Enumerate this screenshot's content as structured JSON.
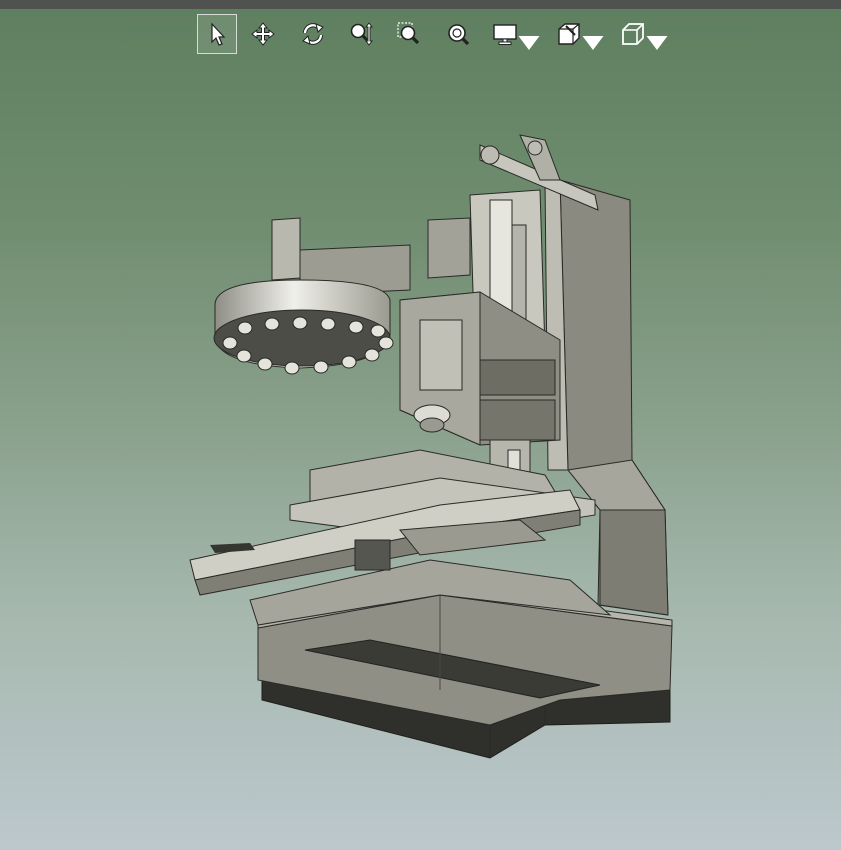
{
  "toolbar": {
    "tools": [
      {
        "id": "select",
        "icon": "select-arrow-icon",
        "active": true,
        "dropdown": false
      },
      {
        "id": "pan",
        "icon": "pan-move-icon",
        "active": false,
        "dropdown": false
      },
      {
        "id": "rotate",
        "icon": "rotate-icon",
        "active": false,
        "dropdown": false
      },
      {
        "id": "zoom",
        "icon": "zoom-updown-icon",
        "active": false,
        "dropdown": false
      },
      {
        "id": "zoom-window",
        "icon": "zoom-window-icon",
        "active": false,
        "dropdown": false
      },
      {
        "id": "zoom-fit",
        "icon": "zoom-fit-icon",
        "active": false,
        "dropdown": false
      },
      {
        "id": "display-mode",
        "icon": "monitor-display-icon",
        "active": false,
        "dropdown": true
      },
      {
        "id": "section-view",
        "icon": "section-view-icon",
        "active": false,
        "dropdown": true
      },
      {
        "id": "view-orientation",
        "icon": "view-cube-icon",
        "active": false,
        "dropdown": true
      }
    ]
  },
  "colors": {
    "bar": "#4f524f",
    "bg_top": "#5e7f5f",
    "bg_bottom": "#bcc8cd",
    "metal_light": "#c9c9c0",
    "metal_mid": "#9d9d92",
    "metal_dark": "#6d6d64",
    "base_shadow": "#2f302b",
    "edge": "#2a2a26"
  }
}
